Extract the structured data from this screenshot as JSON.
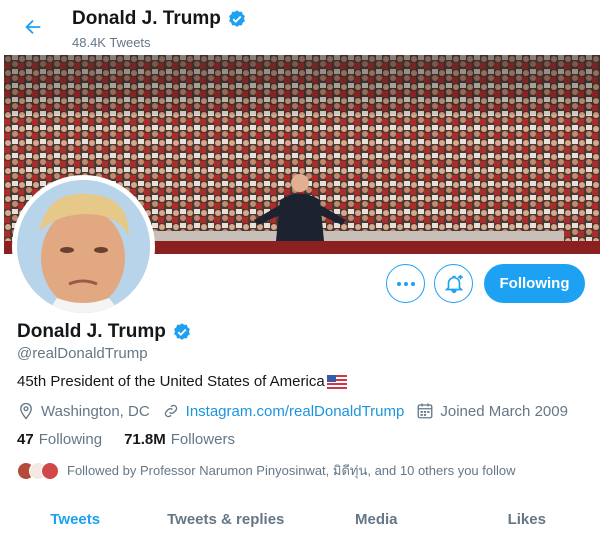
{
  "header": {
    "name": "Donald J. Trump",
    "tweets_count": "48.4K Tweets"
  },
  "profile": {
    "name": "Donald J. Trump",
    "handle": "@realDonaldTrump",
    "bio": "45th President of the United States of America",
    "location": "Washington, DC",
    "website": "Instagram.com/realDonaldTrump",
    "joined": "Joined March 2009",
    "following_count": "47",
    "following_label": "Following",
    "followers_count": "71.8M",
    "followers_label": "Followers",
    "followed_by": "Followed by Professor Narumon Pinyosinwat, มิดีทุ่น, and 10 others you follow"
  },
  "actions": {
    "following_button": "Following"
  },
  "tabs": [
    {
      "label": "Tweets",
      "active": true
    },
    {
      "label": "Tweets & replies",
      "active": false
    },
    {
      "label": "Media",
      "active": false
    },
    {
      "label": "Likes",
      "active": false
    }
  ],
  "colors": {
    "accent": "#1da1f2",
    "link": "#1b95e0",
    "secondary_text": "#657786"
  },
  "icons": [
    "back-arrow-icon",
    "verified-badge-icon",
    "more-icon",
    "notification-bell-icon",
    "location-icon",
    "link-icon",
    "calendar-icon",
    "us-flag-icon"
  ]
}
